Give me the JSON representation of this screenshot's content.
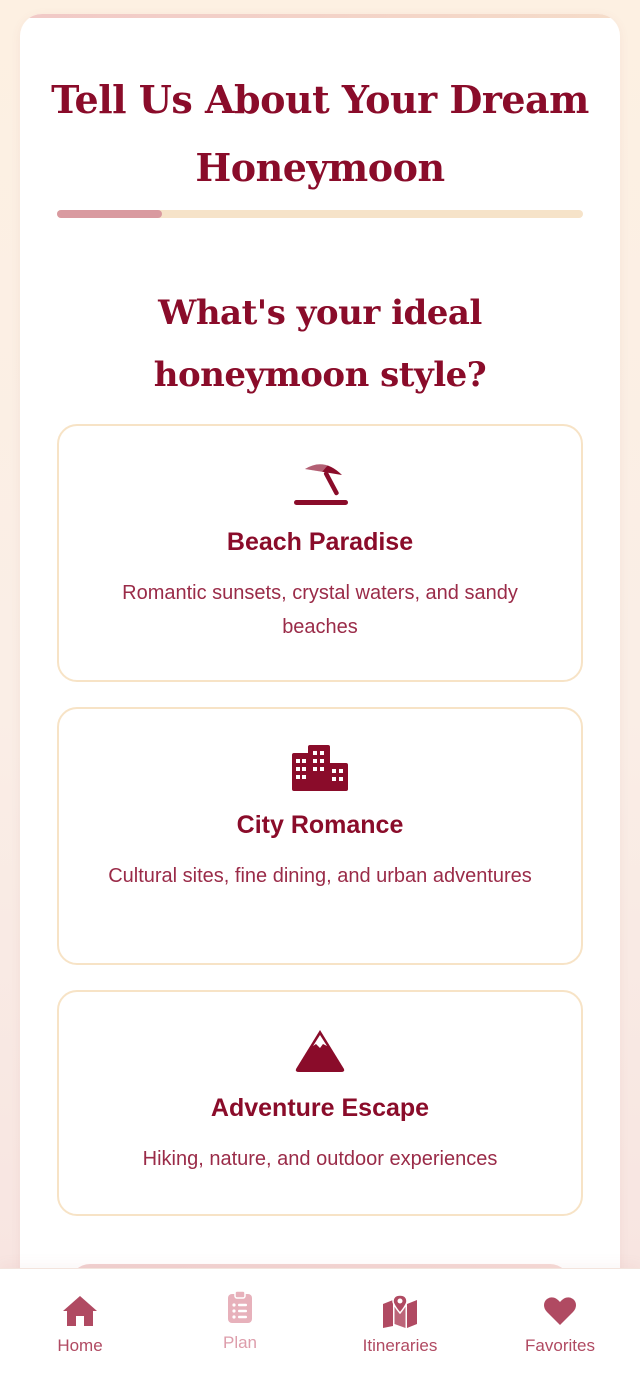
{
  "page": {
    "title": "Tell Us About Your Dream Honeymoon",
    "progress": 0.2,
    "question": "What's your ideal honeymoon style?"
  },
  "options": [
    {
      "icon": "umbrella-beach-icon",
      "title": "Beach Paradise",
      "description": "Romantic sunsets, crystal waters, and sandy beaches"
    },
    {
      "icon": "city-buildings-icon",
      "title": "City Romance",
      "description": "Cultural sites, fine dining, and urban adventures"
    },
    {
      "icon": "mountain-icon",
      "title": "Adventure Escape",
      "description": "Hiking, nature, and outdoor experiences"
    }
  ],
  "nav": {
    "items": [
      {
        "label": "Home",
        "icon": "home-icon"
      },
      {
        "label": "Plan",
        "icon": "clipboard-list-icon"
      },
      {
        "label": "Itineraries",
        "icon": "map-location-icon"
      },
      {
        "label": "Favorites",
        "icon": "heart-icon"
      }
    ]
  },
  "colors": {
    "primary": "#8a0c2a",
    "text_secondary": "#9a2b48",
    "card_border": "#f7e3c6",
    "progress_fill": "#d99aa0",
    "progress_track": "#f6e3c9",
    "nav_active": "#b04a62",
    "nav_inactive": "#dd9dab"
  }
}
